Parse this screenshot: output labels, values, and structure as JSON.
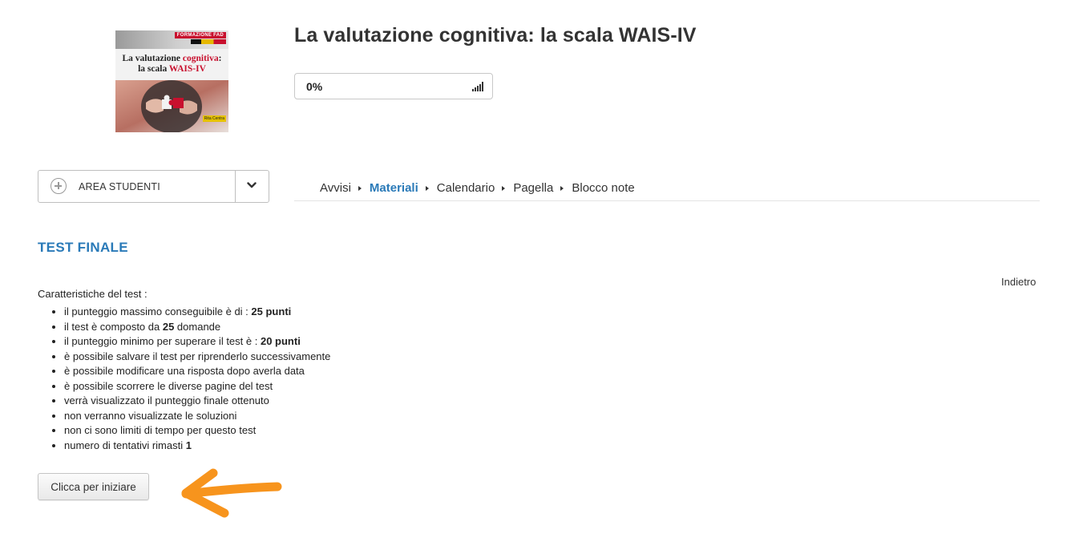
{
  "course": {
    "title": "La valutazione cognitiva: la scala WAIS-IV",
    "cover": {
      "brand": "FORMAZIONE FAD",
      "title_line1_prefix": "La valutazione ",
      "title_line1_accent": "cognitiva",
      "title_line1_suffix": ":",
      "title_line2_prefix": "la scala ",
      "title_line2_accent": "WAIS-IV",
      "tag": "Rita Centra"
    },
    "progress": {
      "label": "0%",
      "value": 0
    }
  },
  "area_studenti": {
    "label": "AREA STUDENTI"
  },
  "nav": {
    "items": [
      {
        "label": "Avvisi",
        "active": false
      },
      {
        "label": "Materiali",
        "active": true
      },
      {
        "label": "Calendario",
        "active": false
      },
      {
        "label": "Pagella",
        "active": false
      },
      {
        "label": "Blocco note",
        "active": false
      }
    ]
  },
  "test": {
    "title": "TEST FINALE",
    "back_label": "Indietro",
    "intro": "Caratteristiche del test :",
    "features": [
      {
        "text": "il punteggio massimo conseguibile è di : ",
        "strong": "25 punti",
        "after": ""
      },
      {
        "text": "il test è composto da ",
        "strong": "25",
        "after": " domande"
      },
      {
        "text": "il punteggio minimo per superare il test è : ",
        "strong": "20 punti",
        "after": ""
      },
      {
        "text": "è possibile salvare il test per riprenderlo successivamente",
        "strong": "",
        "after": ""
      },
      {
        "text": "è possibile modificare una risposta dopo averla data",
        "strong": "",
        "after": ""
      },
      {
        "text": "è possibile scorrere le diverse pagine del test",
        "strong": "",
        "after": ""
      },
      {
        "text": "verrà visualizzato il punteggio finale ottenuto",
        "strong": "",
        "after": ""
      },
      {
        "text": "non verranno visualizzate le soluzioni",
        "strong": "",
        "after": ""
      },
      {
        "text": "non ci sono limiti di tempo per questo test",
        "strong": "",
        "after": ""
      },
      {
        "text": "numero di tentativi rimasti ",
        "strong": "1",
        "after": ""
      }
    ],
    "start_label": "Clicca per iniziare"
  },
  "colors": {
    "accent": "#2a7ab8",
    "annotation_arrow": "#f7941d",
    "cover_red": "#c8102e"
  }
}
